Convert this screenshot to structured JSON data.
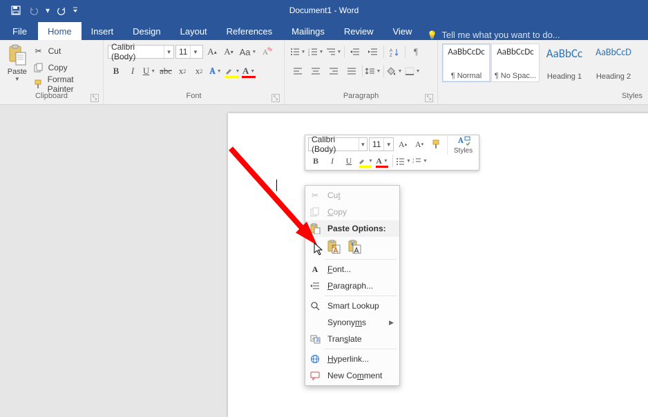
{
  "titlebar": {
    "doc_title": "Document1 - Word"
  },
  "tabs": {
    "file": "File",
    "home": "Home",
    "insert": "Insert",
    "design": "Design",
    "layout": "Layout",
    "references": "References",
    "mailings": "Mailings",
    "review": "Review",
    "view": "View",
    "tellme": "Tell me what you want to do..."
  },
  "clipboard": {
    "paste": "Paste",
    "cut": "Cut",
    "copy": "Copy",
    "format_painter": "Format Painter",
    "group_label": "Clipboard"
  },
  "font": {
    "name": "Calibri (Body)",
    "size": "11",
    "group_label": "Font"
  },
  "paragraph": {
    "group_label": "Paragraph"
  },
  "styles": {
    "group_label": "Styles",
    "tiles": [
      {
        "preview": "AaBbCcDc",
        "name": "¶ Normal",
        "color": "#333"
      },
      {
        "preview": "AaBbCcDc",
        "name": "¶ No Spac...",
        "color": "#333"
      },
      {
        "preview": "AaBbCc",
        "name": "Heading 1",
        "color": "#2e74b5"
      },
      {
        "preview": "AaBbCcD",
        "name": "Heading 2",
        "color": "#2e74b5"
      }
    ]
  },
  "mini": {
    "font": "Calibri (Body)",
    "size": "11",
    "styles": "Styles"
  },
  "ctx": {
    "cut": "Cut",
    "copy": "Copy",
    "paste_options": "Paste Options:",
    "font": "Font...",
    "paragraph": "Paragraph...",
    "smart_lookup": "Smart Lookup",
    "synonyms": "Synonyms",
    "translate": "Translate",
    "hyperlink": "Hyperlink...",
    "new_comment": "New Comment"
  }
}
